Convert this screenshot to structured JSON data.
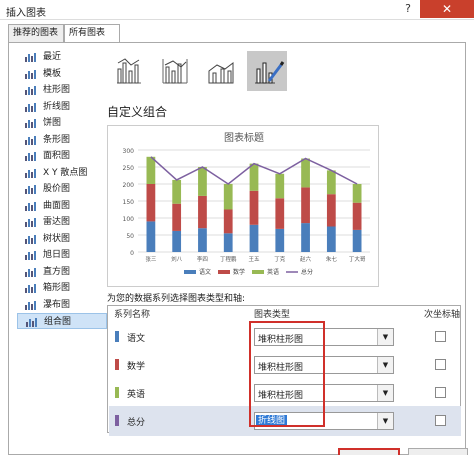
{
  "window": {
    "title": "插入图表",
    "help": "?",
    "close": "✕"
  },
  "tabs": [
    {
      "label": "推荐的图表"
    },
    {
      "label": "所有图表"
    }
  ],
  "sidebar": {
    "items": [
      {
        "label": "最近",
        "icon": "recent-icon"
      },
      {
        "label": "模板",
        "icon": "folder-icon"
      },
      {
        "label": "柱形图",
        "icon": "column-chart-icon"
      },
      {
        "label": "折线图",
        "icon": "line-chart-icon"
      },
      {
        "label": "饼图",
        "icon": "pie-chart-icon"
      },
      {
        "label": "条形图",
        "icon": "bar-chart-icon"
      },
      {
        "label": "面积图",
        "icon": "area-chart-icon"
      },
      {
        "label": "X Y 散点图",
        "icon": "scatter-chart-icon"
      },
      {
        "label": "股价图",
        "icon": "stock-chart-icon"
      },
      {
        "label": "曲面图",
        "icon": "surface-chart-icon"
      },
      {
        "label": "雷达图",
        "icon": "radar-chart-icon"
      },
      {
        "label": "树状图",
        "icon": "treemap-icon"
      },
      {
        "label": "旭日图",
        "icon": "sunburst-icon"
      },
      {
        "label": "直方图",
        "icon": "histogram-icon"
      },
      {
        "label": "箱形图",
        "icon": "boxplot-icon"
      },
      {
        "label": "瀑布图",
        "icon": "waterfall-icon"
      },
      {
        "label": "组合图",
        "icon": "combo-chart-icon"
      }
    ],
    "active_index": 16
  },
  "subtypes": [
    {
      "icon": "combo-cluster-line-icon"
    },
    {
      "icon": "combo-cluster-line-secondary-icon"
    },
    {
      "icon": "combo-stacked-area-icon"
    },
    {
      "icon": "custom-combo-icon",
      "selected": true
    }
  ],
  "section_title": "自定义组合",
  "prompt": "为您的数据系列选择图表类型和轴:",
  "table": {
    "headers": {
      "name": "系列名称",
      "type": "图表类型",
      "secondary": "次坐标轴"
    },
    "rows": [
      {
        "name": "语文",
        "color": "#4a7ebb",
        "type": "堆积柱形图"
      },
      {
        "name": "数学",
        "color": "#be4b48",
        "type": "堆积柱形图"
      },
      {
        "name": "英语",
        "color": "#98b954",
        "type": "堆积柱形图"
      },
      {
        "name": "总分",
        "color": "#7d60a0",
        "type": "折线图"
      }
    ]
  },
  "chart_data": {
    "type": "bar",
    "title": "图表标题",
    "categories": [
      "张三",
      "刘八",
      "李四",
      "丁程鹏",
      "王五",
      "丁克",
      "赵六",
      "朱七",
      "丁大哥"
    ],
    "series": [
      {
        "name": "语文",
        "kind": "stacked-bar",
        "color": "#4a7ebb",
        "values": [
          90,
          62,
          70,
          55,
          80,
          68,
          85,
          75,
          65
        ]
      },
      {
        "name": "数学",
        "kind": "stacked-bar",
        "color": "#be4b48",
        "values": [
          110,
          80,
          95,
          70,
          100,
          90,
          105,
          95,
          80
        ]
      },
      {
        "name": "英语",
        "kind": "stacked-bar",
        "color": "#98b954",
        "values": [
          80,
          70,
          85,
          75,
          80,
          72,
          85,
          70,
          55
        ]
      },
      {
        "name": "总分",
        "kind": "line",
        "color": "#7d60a0",
        "values": [
          280,
          212,
          250,
          200,
          260,
          230,
          275,
          240,
          200
        ]
      }
    ],
    "ylim": [
      0,
      300
    ],
    "yticks": [
      0,
      50,
      100,
      150,
      200,
      250,
      300
    ],
    "grid": true,
    "legend": "bottom",
    "xlabel": "",
    "ylabel": ""
  }
}
